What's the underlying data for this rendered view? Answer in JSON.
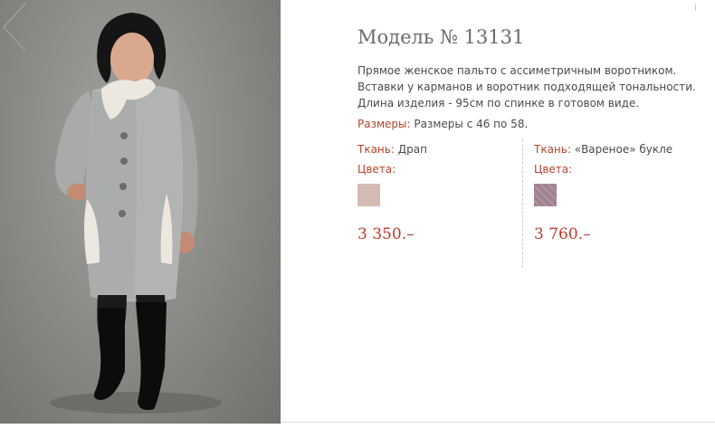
{
  "product": {
    "title": "Модель № 13131",
    "description_lines": [
      "Прямое женское пальто с ассиметричным воротником.",
      "Вставки у карманов и воротник подходящей тональности.",
      "Длина изделия - 95см по спинке в готовом виде."
    ],
    "sizes_label": "Размеры:",
    "sizes_value": "Размеры с 46 по 58."
  },
  "variants": [
    {
      "fabric_label": "Ткань:",
      "fabric_value": "Драп",
      "colors_label": "Цвета:",
      "swatch_color": "#d4bbb4",
      "price": "3 350.–"
    },
    {
      "fabric_label": "Ткань:",
      "fabric_value": "«Вареное» букле",
      "colors_label": "Цвета:",
      "swatch_color": "#a58896",
      "price": "3 760.–"
    }
  ],
  "colors": {
    "accent_red": "#b8432b",
    "price_red": "#c0392b",
    "text": "#4a4a4a",
    "title": "#6d6a66"
  },
  "icons": {
    "gallery_prev": "chevron-left-icon"
  }
}
